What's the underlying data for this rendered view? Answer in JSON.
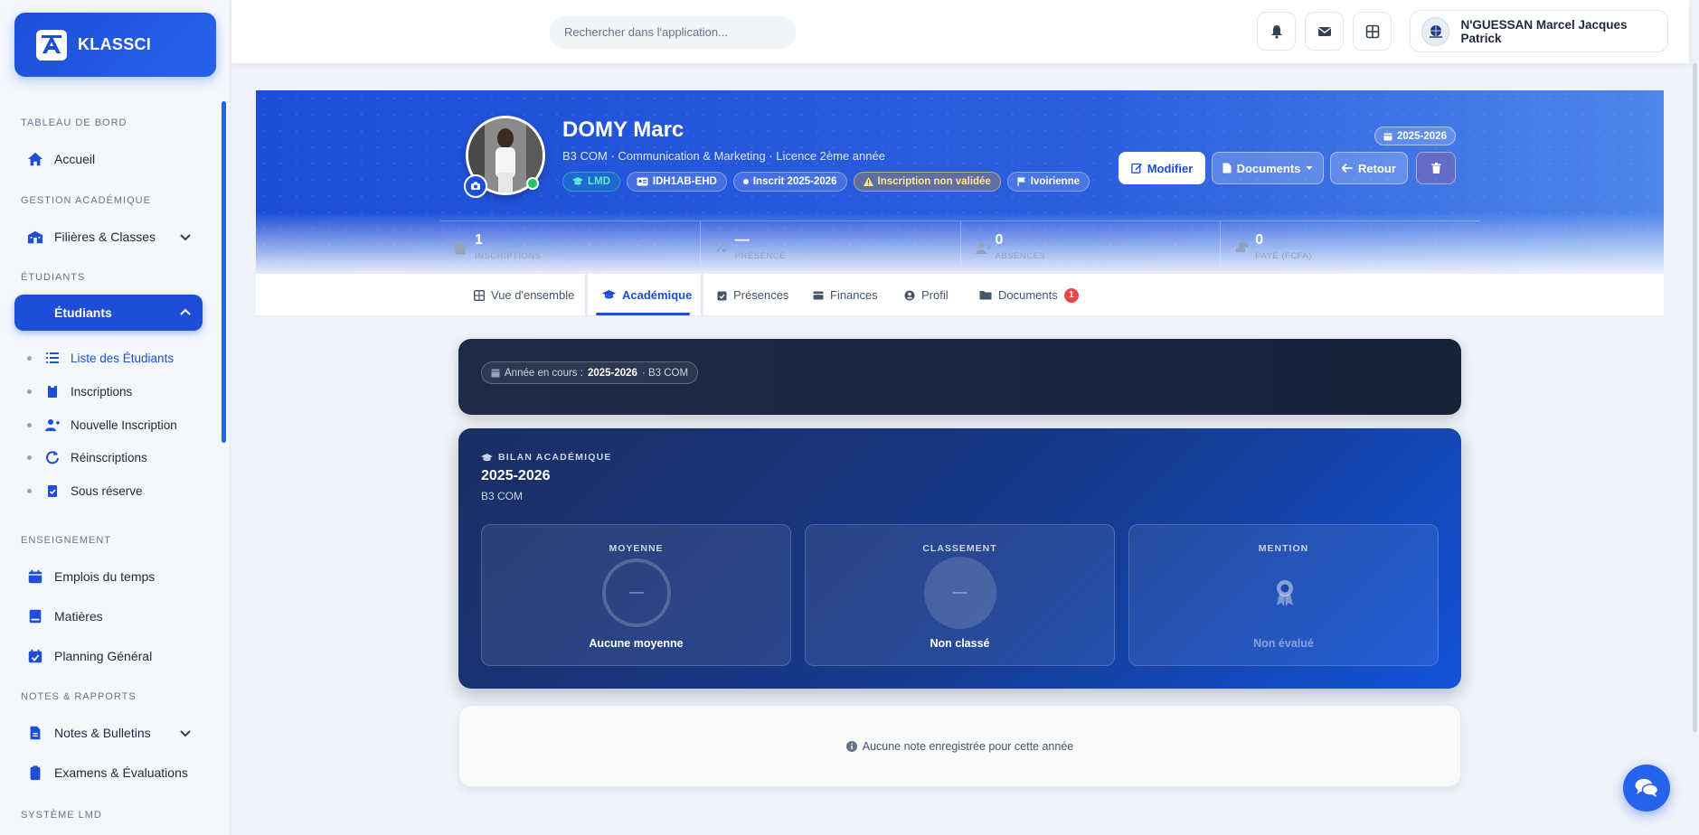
{
  "brand": {
    "name": "KLASSCI"
  },
  "sidebar": {
    "sections": [
      "TABLEAU DE BORD",
      "GESTION ACADÉMIQUE",
      "ÉTUDIANTS",
      "ENSEIGNEMENT",
      "NOTES & RAPPORTS",
      "SYSTÈME LMD"
    ],
    "items": {
      "accueil": "Accueil",
      "filieres": "Filières & Classes",
      "etudiants": "Étudiants",
      "emplois": "Emplois du temps",
      "matieres": "Matières",
      "planning": "Planning Général",
      "notes": "Notes & Bulletins",
      "examens": "Examens & Évaluations"
    },
    "subitems": [
      "Liste des Étudiants",
      "Inscriptions",
      "Nouvelle Inscription",
      "Réinscriptions",
      "Sous réserve"
    ]
  },
  "topbar": {
    "search_placeholder": "Rechercher dans l'application...",
    "user_name": "N'GUESSAN Marcel Jacques Patrick"
  },
  "student": {
    "name": "DOMY Marc",
    "subtitle": "B3 COM · Communication & Marketing · Licence 2ème année",
    "badges": {
      "lmd": "LMD",
      "id": "IDH1AB-EHD",
      "status": "Inscrit 2025-2026",
      "warning": "Inscription non validée",
      "nationality": "Ivoirienne"
    },
    "year": "2025-2026"
  },
  "actions": {
    "edit": "Modifier",
    "documents": "Documents",
    "back": "Retour"
  },
  "stats": [
    {
      "value": "1",
      "label": "INSCRIPTIONS"
    },
    {
      "value": "—",
      "label": "PRÉSENCE"
    },
    {
      "value": "0",
      "label": "ABSENCES"
    },
    {
      "value": "0",
      "label": "PAYÉ (FCFA)"
    }
  ],
  "tabs": [
    "Vue d'ensemble",
    "Académique",
    "Présences",
    "Finances",
    "Profil",
    "Documents"
  ],
  "tab_documents_count": "1",
  "year_bar": {
    "label": "Année en cours :",
    "year": "2025-2026",
    "class": "· B3 COM"
  },
  "bilan": {
    "kicker": "BILAN ACADÉMIQUE",
    "year": "2025-2026",
    "class": "B3 COM",
    "cards": [
      {
        "title": "MOYENNE",
        "value": "—",
        "label": "Aucune moyenne"
      },
      {
        "title": "CLASSEMENT",
        "value": "—",
        "label": "Non classé"
      },
      {
        "title": "MENTION",
        "label": "Non évalué"
      }
    ]
  },
  "empty_notes": "Aucune note enregistrée pour cette année",
  "colors": {
    "primary": "#1d4ed8",
    "success": "#22c55e",
    "warning": "#f59e0b",
    "danger": "#ef4444"
  }
}
